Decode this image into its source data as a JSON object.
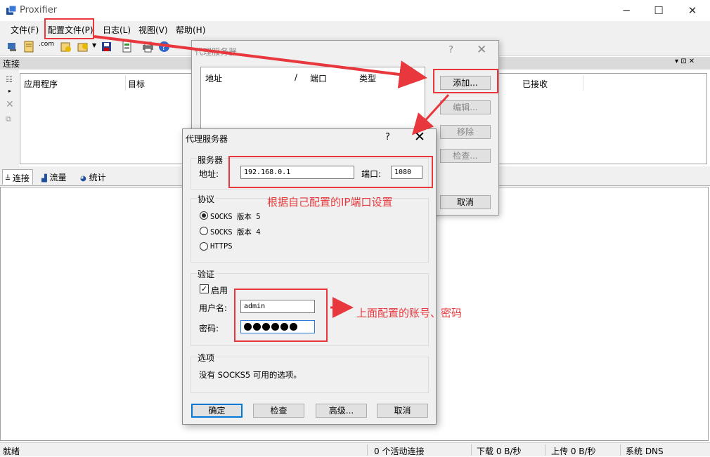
{
  "window": {
    "title": "Proxifier",
    "minimize": "─",
    "maximize": "☐",
    "close": "✕"
  },
  "menu": [
    "文件(F)",
    "配置文件(P)",
    "日志(L)",
    "视图(V)",
    "帮助(H)"
  ],
  "toolbar": {
    "com_label": ".com",
    "icons": [
      "profile-icon",
      "rules-icon",
      "domain-icon",
      "proxy-server-icon",
      "proxy-rules-icon",
      "save-icon",
      "resolve-icon",
      "print-icon",
      "help-icon"
    ]
  },
  "connections": {
    "header": "连接",
    "pin": "▾ ⊡ ✕",
    "columns": [
      "应用程序",
      "目标",
      "已接收"
    ]
  },
  "tabs": [
    "连接",
    "流量",
    "统计"
  ],
  "status": {
    "ready": "就绪",
    "active": "0 个活动连接",
    "down": "下载 0 B/秒",
    "up": "上传 0 B/秒",
    "dns": "系统 DNS"
  },
  "dialog_list": {
    "title": "代理服务器",
    "help": "?",
    "close": "✕",
    "columns": [
      "地址",
      "/",
      "端口",
      "类型"
    ],
    "buttons": {
      "add": "添加...",
      "edit": "编辑...",
      "remove": "移除",
      "check": "检查...",
      "cancel": "取消"
    }
  },
  "dialog_edit": {
    "title": "代理服务器",
    "help": "?",
    "close": "✕",
    "server_group": "服务器",
    "address_label": "地址:",
    "address_value": "192.168.0.1",
    "port_label": "端口:",
    "port_value": "1080",
    "protocol_group": "协议",
    "protocols": [
      "SOCKS 版本 5",
      "SOCKS 版本 4",
      "HTTPS"
    ],
    "selected_protocol": "SOCKS 版本 5",
    "auth_group": "验证",
    "enable_label": "启用",
    "enable_checked": true,
    "username_label": "用户名:",
    "username_value": "admin",
    "password_label": "密码:",
    "password_dots": 6,
    "options_group": "选项",
    "options_text": "没有 SOCKS5 可用的选项。",
    "buttons": {
      "ok": "确定",
      "check": "检查",
      "advanced": "高级...",
      "cancel": "取消"
    }
  },
  "annotations": {
    "ip_note": "根据自己配置的IP端口设置",
    "account_note": "上面配置的账号、密码",
    "color": "#e8383d"
  }
}
